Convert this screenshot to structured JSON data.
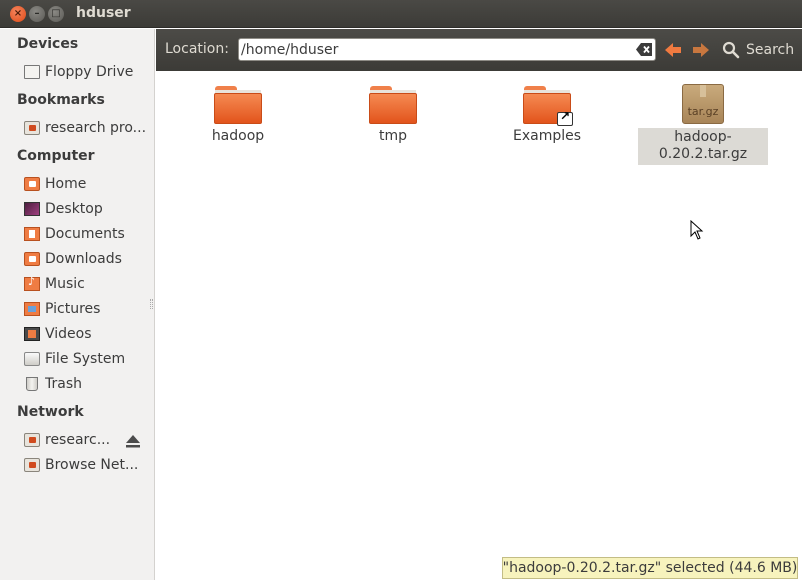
{
  "window": {
    "title": "hduser"
  },
  "sidebar": {
    "sections": [
      {
        "heading": "Devices",
        "items": [
          {
            "label": "Floppy Drive",
            "icon": "floppy-icon"
          }
        ]
      },
      {
        "heading": "Bookmarks",
        "items": [
          {
            "label": "research pro...",
            "icon": "network-folder-icon"
          }
        ]
      },
      {
        "heading": "Computer",
        "items": [
          {
            "label": "Home",
            "icon": "home-folder-icon"
          },
          {
            "label": "Desktop",
            "icon": "desktop-icon"
          },
          {
            "label": "Documents",
            "icon": "documents-folder-icon"
          },
          {
            "label": "Downloads",
            "icon": "downloads-folder-icon"
          },
          {
            "label": "Music",
            "icon": "music-folder-icon"
          },
          {
            "label": "Pictures",
            "icon": "pictures-folder-icon"
          },
          {
            "label": "Videos",
            "icon": "videos-folder-icon"
          },
          {
            "label": "File System",
            "icon": "harddisk-icon"
          },
          {
            "label": "Trash",
            "icon": "trash-icon"
          }
        ]
      },
      {
        "heading": "Network",
        "items": [
          {
            "label": "researc...",
            "icon": "network-folder-icon",
            "eject": true
          },
          {
            "label": "Browse Net...",
            "icon": "network-folder-icon"
          }
        ]
      }
    ]
  },
  "location": {
    "label": "Location:",
    "path": "/home/hduser",
    "search_label": "Search"
  },
  "files": [
    {
      "name": "hadoop",
      "type": "folder"
    },
    {
      "name": "tmp",
      "type": "folder"
    },
    {
      "name": "Examples",
      "type": "folder-link"
    },
    {
      "name": "hadoop-0.20.2.tar.gz",
      "type": "archive",
      "icon_text": "tar.gz",
      "selected": true
    }
  ],
  "status": "\"hadoop-0.20.2.tar.gz\" selected (44.6 MB)",
  "colors": {
    "accent": "#e2541c",
    "titlebar": "#3c3b37",
    "sidebar_bg": "#f2f1f0"
  }
}
